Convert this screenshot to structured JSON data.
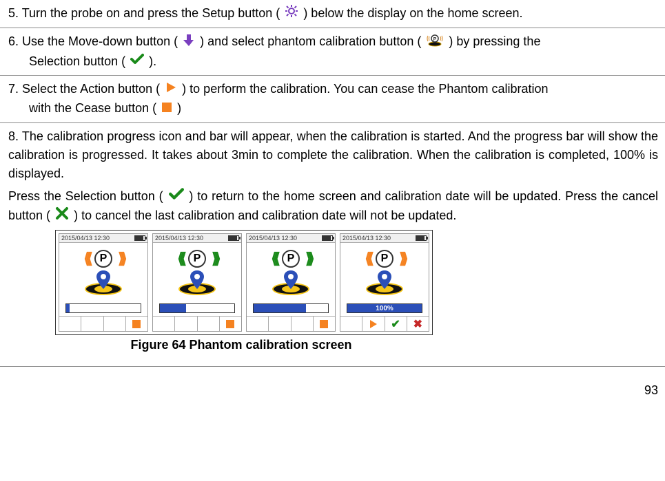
{
  "steps": {
    "s5": {
      "prefix": "5. Turn the probe on and press the Setup button (",
      "suffix": ") below the display on the home screen."
    },
    "s6": {
      "p1": "6. Use the Move-down button (",
      "p2": ") and select phantom calibration button (",
      "p3": ") by pressing the",
      "indent1": "Selection button (",
      "indent2": ")."
    },
    "s7": {
      "p1": "7. Select the Action button (",
      "p2": ") to perform the calibration. You can cease the Phantom calibration",
      "indent1": "with the Cease button (",
      "indent2": ")"
    },
    "s8": {
      "line1": "8. The calibration progress icon and bar will appear, when the calibration is started. And the progress bar will show the calibration is progressed. It takes about 3min to complete the calibration. When the calibration is completed, 100% is displayed.",
      "line2a": "Press the Selection button (",
      "line2b": ") to return to the home screen and calibration date will be updated. Press the cancel button (",
      "line2c": ") to cancel the last calibration and calibration date will not be updated."
    }
  },
  "caption": "Figure 64 Phantom calibration screen",
  "page_number": "93",
  "screens": [
    {
      "timestamp": "2015/04/13 12:30",
      "chev_color": "orange",
      "progress_pct": 5,
      "progress_label": "",
      "footer": [
        "",
        "",
        "",
        "cease"
      ]
    },
    {
      "timestamp": "2015/04/13 12:30",
      "chev_color": "green",
      "progress_pct": 35,
      "progress_label": "",
      "footer": [
        "",
        "",
        "",
        "cease"
      ]
    },
    {
      "timestamp": "2015/04/13 12:30",
      "chev_color": "green",
      "progress_pct": 70,
      "progress_label": "",
      "footer": [
        "",
        "",
        "",
        "cease"
      ]
    },
    {
      "timestamp": "2015/04/13 12:30",
      "chev_color": "orange",
      "progress_pct": 100,
      "progress_label": "100%",
      "footer": [
        "",
        "play",
        "check",
        "cancel"
      ]
    }
  ]
}
